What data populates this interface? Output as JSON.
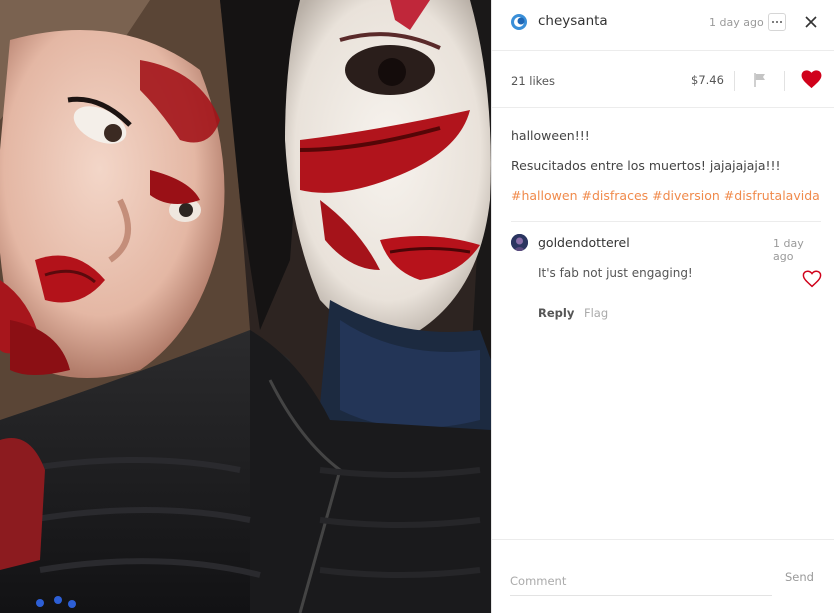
{
  "post": {
    "author": "cheysanta",
    "time_ago": "1 day ago",
    "likes": "21 likes",
    "payout": "$7.46",
    "title": "halloween!!!",
    "body": "Resucitados entre los muertos! jajajajaja!!!",
    "tags": [
      "#hallowen",
      "#disfraces",
      "#diversion",
      "#disfrutalavida"
    ]
  },
  "comment": {
    "author": "goldendotterel",
    "time_ago": "1 day ago",
    "text": "It's fab not just engaging!",
    "reply_label": "Reply",
    "flag_label": "Flag"
  },
  "composer": {
    "placeholder": "Comment",
    "send_label": "Send"
  },
  "icons": {
    "more": "more-options-icon",
    "close": "close-icon",
    "flag": "flag-icon",
    "like": "heart-icon"
  },
  "colors": {
    "like_red": "#d0021b",
    "tag_orange": "#f08a4b",
    "muted_text": "#9a9a9a"
  }
}
